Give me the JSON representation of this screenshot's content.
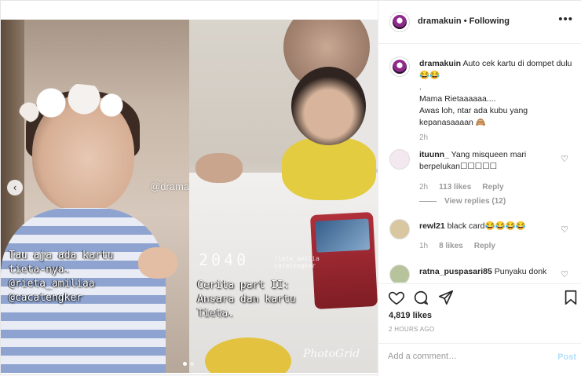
{
  "post": {
    "username": "dramakuin",
    "separator": "•",
    "follow_status": "Following",
    "more": "•••"
  },
  "media": {
    "left_overlay_line1": "Tau aja ada kartu",
    "left_overlay_line2": "tieta-nya.",
    "left_handle1": "@rieta_amiliaa",
    "left_handle2": "@cacatengker",
    "watermark": "@dramakuin",
    "counter": "2040",
    "mini_credit_line1": "rieta_amilia",
    "mini_credit_line2": "cacatengker",
    "right_overlay_line1": "Cerita part II:",
    "right_overlay_line2": "Ansara dan kartu",
    "right_overlay_line3": "Tieta.",
    "photogrid": "PhotoGrid",
    "slide_count": 2,
    "active_slide": 1
  },
  "caption": {
    "username": "dramakuin",
    "line1": "Auto cek kartu di dompet dulu 😂😂",
    "line2": ".",
    "line3": "Mama Rietaaaaaa....",
    "line4": "Awas loh, ntar ada kubu yang kepanasaaaan 🙈",
    "time": "2h"
  },
  "comments": [
    {
      "username": "ituunn_",
      "text": "Yang misqueen mari berpelukan☐☐☐☐☐",
      "time": "2h",
      "likes": "113 likes",
      "reply": "Reply",
      "view_replies": "View replies (12)"
    },
    {
      "username": "rewl21",
      "text": "black card😂😂😂😂",
      "time": "1h",
      "likes": "8 likes",
      "reply": "Reply"
    },
    {
      "username": "ratna_puspasari85",
      "text": "Punyaku donk"
    }
  ],
  "actions": {
    "likes": "4,819 likes",
    "time_ago": "2 HOURS AGO"
  },
  "add_comment": {
    "placeholder": "Add a comment…",
    "post_label": "Post"
  }
}
